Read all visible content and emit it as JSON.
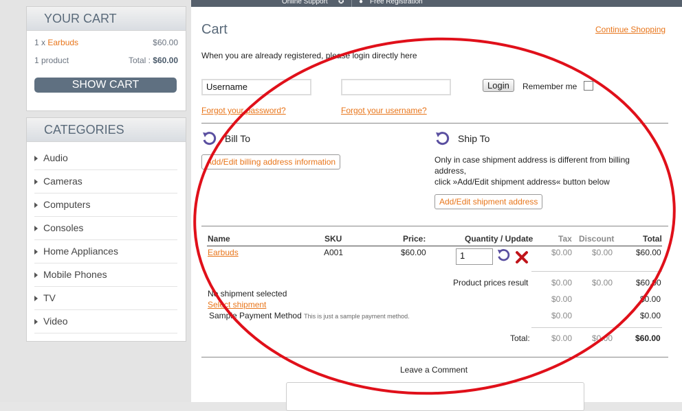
{
  "topbar": {
    "online_support": "Online Support",
    "free_registration": "Free Registration"
  },
  "cart_panel": {
    "title": "YOUR CART",
    "item_qty": "1 x",
    "item_name": "Earbuds",
    "item_price": "$60.00",
    "product_count": "1 product",
    "total_label": "Total :",
    "total_value": "$60.00",
    "show_cart": "SHOW CART"
  },
  "categories": {
    "title": "CATEGORIES",
    "items": [
      "Audio",
      "Cameras",
      "Computers",
      "Consoles",
      "Home Appliances",
      "Mobile Phones",
      "TV",
      "Video"
    ]
  },
  "main": {
    "title": "Cart",
    "continue_shopping": "Continue Shopping",
    "login_intro": "When you are already registered, please login directly here",
    "username_value": "Username",
    "password_value": "",
    "login_button": "Login",
    "remember_me": "Remember me",
    "forgot_password": "Forgot your password?",
    "forgot_username": "Forgot your username?",
    "bill_to": "Bill To",
    "ship_to": "Ship To",
    "billing_button": "Add/Edit billing address information",
    "ship_note1": "Only in case shipment address is different from billing",
    "ship_note2": "address,",
    "ship_note3": "click »Add/Edit shipment address« button below",
    "shipment_button": "Add/Edit shipment address"
  },
  "table": {
    "headers": {
      "name": "Name",
      "sku": "SKU",
      "price": "Price:",
      "qty": "Quantity / Update",
      "tax": "Tax",
      "discount": "Discount",
      "total": "Total"
    },
    "row": {
      "name": "Earbuds",
      "sku": "A001",
      "price": "$60.00",
      "qty": "1",
      "tax": "$0.00",
      "discount": "$0.00",
      "total": "$60.00"
    },
    "product_prices_label": "Product prices result",
    "pp_tax": "$0.00",
    "pp_discount": "$0.00",
    "pp_total": "$60.00",
    "no_shipment": "No shipment selected",
    "select_shipment": "Select shipment",
    "ship_tax": "$0.00",
    "ship_total": "$0.00",
    "payment_method": "Sample Payment Method",
    "payment_desc": "This is just a sample payment method.",
    "pay_tax": "$0.00",
    "pay_total": "$0.00",
    "total_label": "Total:",
    "grand_tax": "$0.00",
    "grand_discount": "$0.00",
    "grand_total": "$60.00"
  },
  "comment": {
    "label": "Leave a Comment"
  },
  "colors": {
    "accent": "#e8751a",
    "annotation": "#e0101a",
    "panel_head": "#5a6a7a"
  },
  "icons": [
    "refresh-icon",
    "delete-icon",
    "user-icon",
    "support-icon"
  ]
}
